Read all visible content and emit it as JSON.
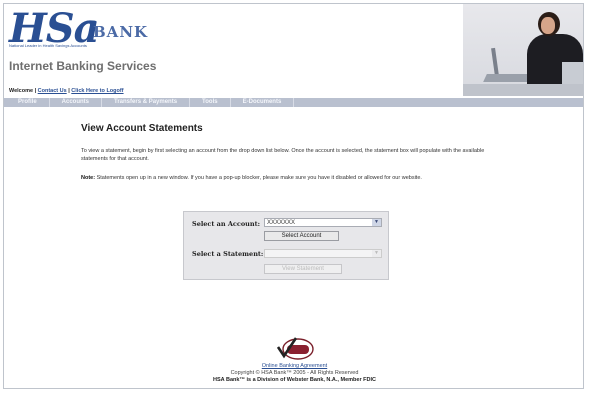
{
  "header": {
    "logo_main": "HSa",
    "logo_bank": "BANK",
    "logo_tagline": "National Leader in Health Savings Accounts",
    "app_title": "Internet Banking Services",
    "welcome_text": "Welcome |",
    "contact_link": "Contact Us",
    "logoff_link": "Click Here to Logoff"
  },
  "nav": {
    "items": [
      "Profile",
      "Accounts",
      "Transfers & Payments",
      "Tools",
      "E-Documents"
    ]
  },
  "main": {
    "title": "View Account Statements",
    "intro": "To view a statement, begin by first selecting an account from the drop down list below. Once the account is selected, the statement box will populate with the available statements for that account.",
    "note_label": "Note:",
    "note_text": "Statements open up in a new window. If you have a pop-up blocker, please make sure you have it disabled or allowed for our website."
  },
  "form": {
    "account_label": "Select an Account:",
    "account_value": "XXXXXXX",
    "select_account_button": "Select Account",
    "statement_label": "Select a Statement:",
    "statement_value": "",
    "view_statement_button": "View Statement"
  },
  "footer": {
    "seal_text": "VeriSign Secured",
    "agreement_link": "Online Banking Agreement",
    "copyright": "Copyright © HSA Bank™ 2005 - All Rights Reserved",
    "division": "HSA Bank™ is a Division of Webster Bank, N.A., Member FDIC"
  },
  "colors": {
    "brand_blue": "#2a4f93",
    "nav_bg": "#b9c0cf",
    "form_bg": "#e7e7ea"
  }
}
